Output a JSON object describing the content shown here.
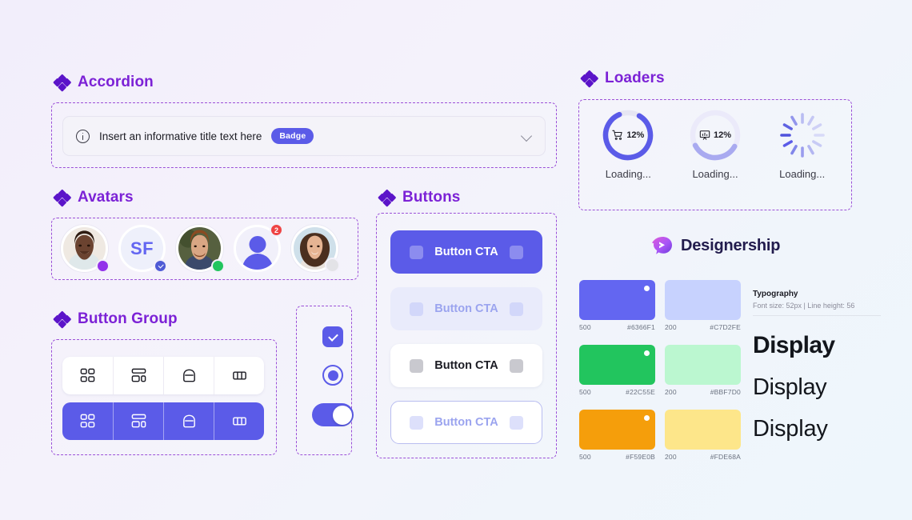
{
  "sections": {
    "accordion": {
      "title": "Accordion"
    },
    "avatars": {
      "title": "Avatars"
    },
    "button_group": {
      "title": "Button Group"
    },
    "buttons": {
      "title": "Buttons"
    },
    "loaders": {
      "title": "Loaders"
    }
  },
  "accordion": {
    "icon": "info-circle-icon",
    "title": "Insert an informative title text here",
    "badge": "Badge",
    "chevron": "chevron-down-icon"
  },
  "avatars": [
    {
      "type": "photo",
      "name": "avatar-photo-1",
      "status": "purple-dot"
    },
    {
      "type": "initials",
      "name": "avatar-initials",
      "initials": "SF",
      "status": "verified-check"
    },
    {
      "type": "photo",
      "name": "avatar-photo-2",
      "status": "green-dot"
    },
    {
      "type": "placeholder",
      "name": "avatar-placeholder",
      "count": "2"
    },
    {
      "type": "photo",
      "name": "avatar-photo-3",
      "status": "gray-dot"
    }
  ],
  "buttons": [
    {
      "label": "Button CTA",
      "variant": "primary"
    },
    {
      "label": "Button CTA",
      "variant": "soft"
    },
    {
      "label": "Button CTA",
      "variant": "white"
    },
    {
      "label": "Button CTA",
      "variant": "outline"
    }
  ],
  "button_group": {
    "icons": [
      "grid-icon",
      "dashboard-layout-icon",
      "archive-box-icon",
      "columns-icon"
    ]
  },
  "controls": {
    "checkbox": {
      "name": "checkbox-checked",
      "state": "checked"
    },
    "radio": {
      "name": "radio-selected",
      "state": "selected"
    },
    "toggle": {
      "name": "toggle-switch",
      "state": "on"
    }
  },
  "loaders": [
    {
      "icon": "shopping-cart-icon",
      "percent": "12%",
      "label": "Loading...",
      "variant": "solid"
    },
    {
      "icon": "presentation-chart-icon",
      "percent": "12%",
      "label": "Loading...",
      "variant": "light"
    },
    {
      "icon": "spinner-icon",
      "percent": "",
      "label": "Loading...",
      "variant": "spokes"
    }
  ],
  "brand": {
    "name": "Designership",
    "logo": "designership-logo"
  },
  "swatches": [
    {
      "tone": "500",
      "hex": "#6366F1",
      "color": "#6366F1",
      "has_dot": true
    },
    {
      "tone": "200",
      "hex": "#C7D2FE",
      "color": "#C7D2FE",
      "has_dot": false
    },
    {
      "tone": "500",
      "hex": "#22C55E",
      "color": "#22C55E",
      "has_dot": true
    },
    {
      "tone": "200",
      "hex": "#BBF7D0",
      "color": "#BBF7D0",
      "has_dot": false
    },
    {
      "tone": "500",
      "hex": "#F59E0B",
      "color": "#F59E0B",
      "has_dot": true
    },
    {
      "tone": "200",
      "hex": "#FDE68A",
      "color": "#FDE68A",
      "has_dot": false
    }
  ],
  "typography": {
    "heading": "Typography",
    "specs": "Font size: 52px | Line height: 56",
    "samples": [
      "Display",
      "Display",
      "Display"
    ]
  },
  "theme": {
    "accent": "#5B5BE8",
    "heading_purple": "#7C22D6",
    "frame_dash": "#9B4FD8"
  }
}
